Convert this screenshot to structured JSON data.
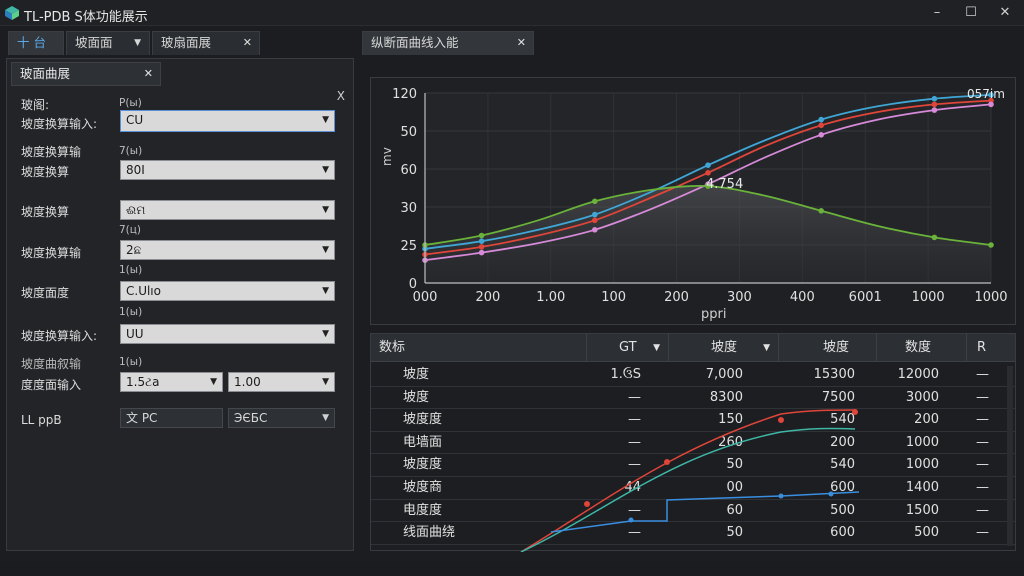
{
  "window": {
    "title": "TL-PDB S体功能展示",
    "controls": {
      "minimize": "–",
      "maximize": "☐",
      "close": "✕"
    }
  },
  "top_tabs": [
    {
      "label": "十 台"
    },
    {
      "label": "坡面面"
    },
    {
      "label": "玻扇面展"
    }
  ],
  "right_tab": {
    "label": "纵断面曲线入能"
  },
  "left_panel": {
    "tab_label": "玻面曲展",
    "close": "X",
    "rows": [
      {
        "label": "玻阁:",
        "sub": "P(ы)"
      },
      {
        "label": "坡度换算输入:",
        "value": "CU"
      },
      {
        "label": "坡度换算输",
        "sub": "7(ы)"
      },
      {
        "label": "坡度换算",
        "value": "80I"
      },
      {
        "label": "坡度换算",
        "value": "ଈମ",
        "sub": "7(ц)"
      },
      {
        "label": "坡度换算输",
        "value": "2ଛ",
        "sub": "1(ы)"
      },
      {
        "label": "坡度面度",
        "value": "C.Ulıo",
        "sub": "1(ы)"
      },
      {
        "label": "坡度换算输入:",
        "value": "UU"
      },
      {
        "label": "坡度曲叙输",
        "sub": "1(ы)"
      },
      {
        "label": "度度面输入",
        "value_a": "1.5ટ​a",
        "value_b": "1.00"
      },
      {
        "label": "LL ppB",
        "value_a": "文 PC",
        "value_b": "ЭЄБС"
      }
    ]
  },
  "chart_data": {
    "type": "line",
    "title": "",
    "xlabel": "ppri",
    "ylabel": "mv",
    "x_ticks": [
      "000",
      "200",
      "1.00",
      "100",
      "200",
      "300",
      "400",
      "6001",
      "1000",
      "1000"
    ],
    "y_ticks": [
      "0",
      "25",
      "30",
      "60",
      "50",
      "120"
    ],
    "annotations": [
      "4.754",
      "057im"
    ],
    "colors": {
      "blue": "#3fa6d6",
      "red": "#e0453a",
      "pink": "#d68ad8",
      "green": "#6ab23a",
      "teal": "#3fb6a6"
    },
    "series": [
      {
        "color": "#3fa6d6",
        "values": [
          0.18,
          0.22,
          0.28,
          0.36,
          0.48,
          0.62,
          0.75,
          0.86,
          0.93,
          0.97,
          0.99
        ]
      },
      {
        "color": "#e0453a",
        "values": [
          0.15,
          0.19,
          0.25,
          0.33,
          0.45,
          0.58,
          0.72,
          0.83,
          0.9,
          0.94,
          0.96
        ]
      },
      {
        "color": "#d68ad8",
        "values": [
          0.12,
          0.16,
          0.21,
          0.28,
          0.39,
          0.52,
          0.66,
          0.78,
          0.86,
          0.91,
          0.94
        ]
      },
      {
        "color": "#6ab23a",
        "values": [
          0.2,
          0.25,
          0.33,
          0.43,
          0.49,
          0.51,
          0.46,
          0.38,
          0.3,
          0.24,
          0.2
        ]
      }
    ]
  },
  "table": {
    "headers": [
      {
        "label": "数标"
      },
      {
        "label": "GT"
      },
      {
        "label": "坡度"
      },
      {
        "label": "坡度"
      },
      {
        "label": "数度"
      },
      {
        "label": "R"
      }
    ],
    "rows": [
      [
        "坡度",
        "1.ઉS",
        "7,000",
        "15300",
        "12000",
        "—"
      ],
      [
        "坡度",
        "—",
        "8300",
        "7500",
        "3000",
        "—"
      ],
      [
        "坡度度",
        "—",
        "150",
        "540",
        "200",
        "—"
      ],
      [
        "电墙面",
        "—",
        "260",
        "200",
        "1000",
        "—"
      ],
      [
        "坡度度",
        "—",
        "50",
        "540",
        "1000",
        "—"
      ],
      [
        "坡度商",
        "44",
        "00",
        "600",
        "1400",
        "—"
      ],
      [
        "电度度",
        "—",
        "60",
        "500",
        "1500",
        "—"
      ],
      [
        "线面曲绕",
        "—",
        "50",
        "600",
        "500",
        "—"
      ]
    ]
  }
}
